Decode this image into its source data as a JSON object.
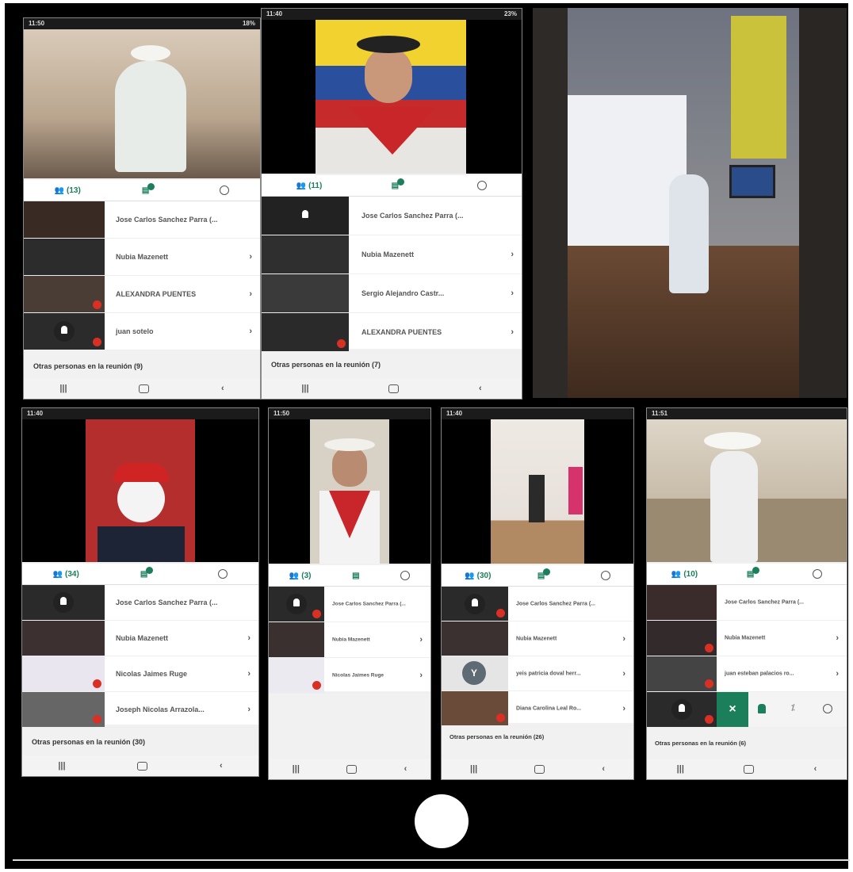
{
  "panel1": {
    "participants_count": "(13)",
    "rows": [
      {
        "name": "Jose Carlos Sanchez Parra (..."
      },
      {
        "name": "Nubia Mazenett"
      },
      {
        "name": "ALEXANDRA PUENTES"
      },
      {
        "name": "juan sotelo"
      }
    ],
    "others": "Otras personas en la reunión (9)"
  },
  "panel2": {
    "participants_count": "(11)",
    "rows": [
      {
        "name": "Jose Carlos Sanchez Parra (..."
      },
      {
        "name": "Nubia Mazenett"
      },
      {
        "name": "Sergio Alejandro Castr..."
      },
      {
        "name": "ALEXANDRA PUENTES"
      }
    ],
    "others": "Otras personas en la reunión (7)"
  },
  "panel4": {
    "participants_count": "(34)",
    "rows": [
      {
        "name": "Jose Carlos Sanchez Parra (..."
      },
      {
        "name": "Nubia Mazenett"
      },
      {
        "name": "Nicolas Jaimes Ruge"
      },
      {
        "name": "Joseph Nicolas Arrazola..."
      }
    ],
    "others": "Otras personas en la reunión (30)"
  },
  "panel5": {
    "participants_count": "(3)",
    "rows": [
      {
        "name": "Jose Carlos Sanchez Parra (..."
      },
      {
        "name": "Nubia Mazenett"
      },
      {
        "name": "Nicolas Jaimes Ruge"
      }
    ]
  },
  "panel6": {
    "participants_count": "(30)",
    "rows": [
      {
        "name": "Jose Carlos Sanchez Parra (..."
      },
      {
        "name": "Nubia Mazenett"
      },
      {
        "name": "yeis patricia doval herr..."
      },
      {
        "name": "Diana Carolina Leal Ro..."
      }
    ],
    "avatar_letter": "Y",
    "others": "Otras personas en la reunión (26)"
  },
  "panel7": {
    "participants_count": "(10)",
    "rows": [
      {
        "name": "Jose Carlos Sanchez Parra (..."
      },
      {
        "name": "Nubia Mazenett"
      },
      {
        "name": "juan esteban palacios ro..."
      }
    ],
    "close_symbol": "×",
    "others": "Otras personas en la reunión (6)"
  },
  "icons": {
    "people": "people-icon",
    "chat": "chat-icon",
    "info": "info-icon",
    "mic_off": "mic-off-icon",
    "pin": "pin-icon"
  },
  "colors": {
    "accent": "#1a7f5a",
    "mic_off": "#d93025"
  }
}
